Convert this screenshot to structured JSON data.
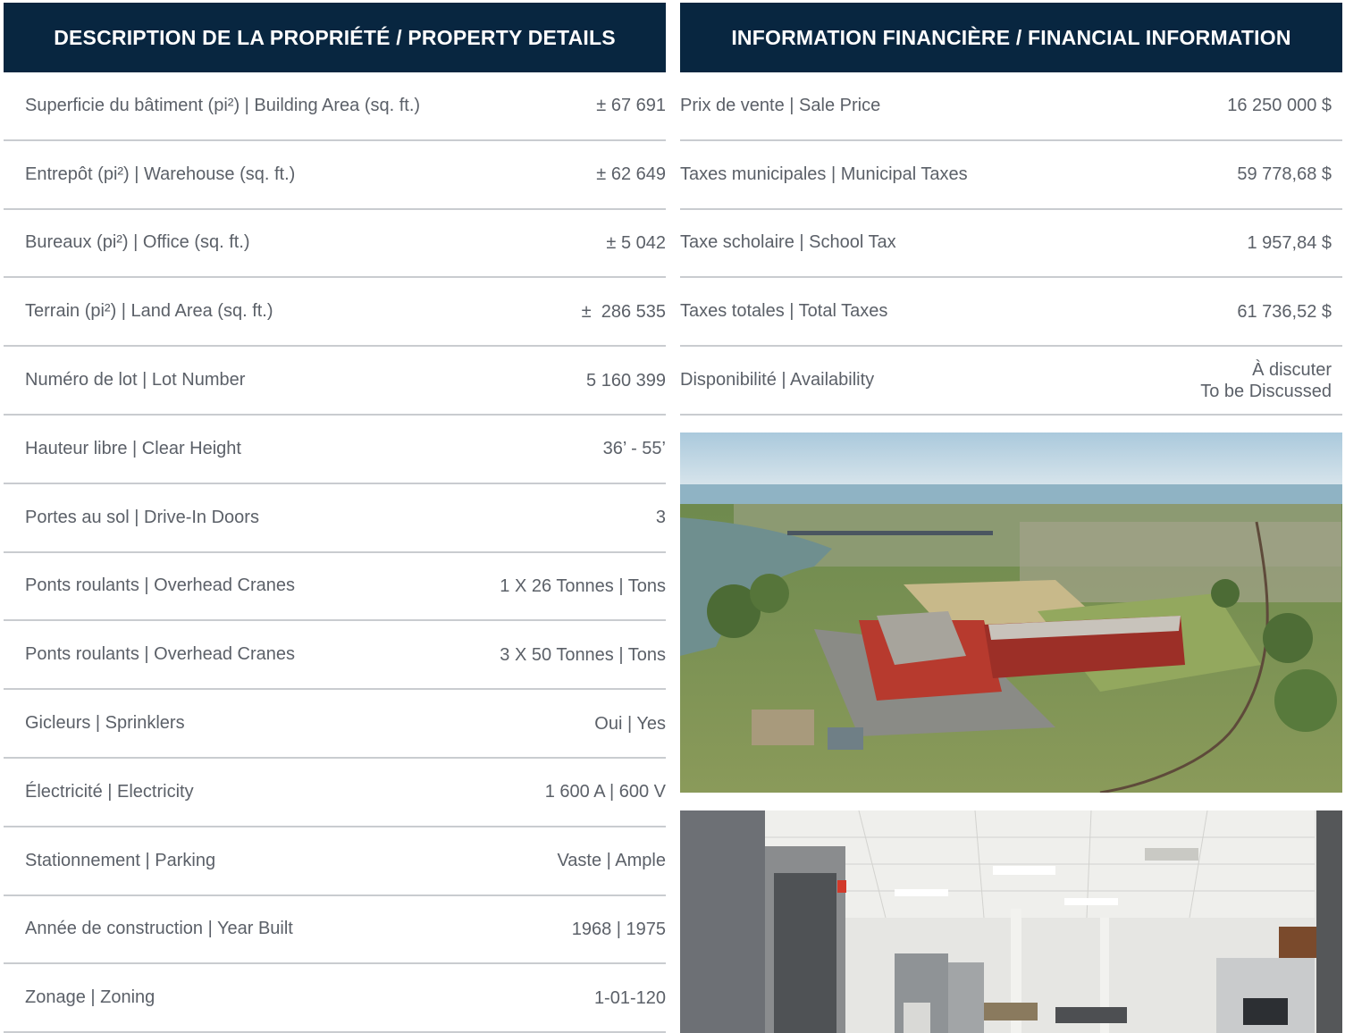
{
  "property_details": {
    "title": "DESCRIPTION DE LA PROPRIÉTÉ / PROPERTY DETAILS",
    "rows": [
      {
        "label": "Superficie du bâtiment (pi²) | Building Area (sq. ft.)",
        "value": "± 67 691"
      },
      {
        "label": "Entrepôt (pi²) | Warehouse (sq. ft.)",
        "value": "± 62 649"
      },
      {
        "label": "Bureaux (pi²) | Office (sq. ft.)",
        "value": "± 5 042"
      },
      {
        "label": "Terrain (pi²) | Land Area (sq. ft.)",
        "value": "±  286 535"
      },
      {
        "label": "Numéro de lot | Lot Number",
        "value": "5 160 399"
      },
      {
        "label": "Hauteur libre | Clear Height",
        "value": "36’ - 55’"
      },
      {
        "label": "Portes au sol | Drive-In Doors",
        "value": "3"
      },
      {
        "label": "Ponts roulants | Overhead Cranes",
        "value": "1 X 26 Tonnes | Tons"
      },
      {
        "label": "Ponts roulants | Overhead Cranes",
        "value": "3 X 50 Tonnes | Tons"
      },
      {
        "label": "Gicleurs | Sprinklers",
        "value": "Oui | Yes"
      },
      {
        "label": "Électricité | Electricity",
        "value": "1 600 A | 600 V"
      },
      {
        "label": "Stationnement | Parking",
        "value": "Vaste | Ample"
      },
      {
        "label": "Année de construction | Year Built",
        "value": "1968 | 1975"
      },
      {
        "label": "Zonage | Zoning",
        "value": "1-01-120"
      }
    ]
  },
  "financial_information": {
    "title": "INFORMATION FINANCIÈRE / FINANCIAL INFORMATION",
    "rows": [
      {
        "label": "Prix de vente | Sale Price",
        "value": "16 250 000 $"
      },
      {
        "label": "Taxes municipales | Municipal Taxes",
        "value": "59 778,68 $"
      },
      {
        "label": "Taxe scholaire | School Tax",
        "value": "1 957,84 $"
      },
      {
        "label": "Taxes totales | Total Taxes",
        "value": "61 736,52 $"
      },
      {
        "label": "Disponibilité | Availability",
        "value": "À discuter",
        "value_line2": "To be Discussed"
      }
    ]
  },
  "colors": {
    "header_background": "#082640",
    "header_text": "#ffffff",
    "body_text": "#5b6068",
    "divider": "#c9ccd0"
  }
}
